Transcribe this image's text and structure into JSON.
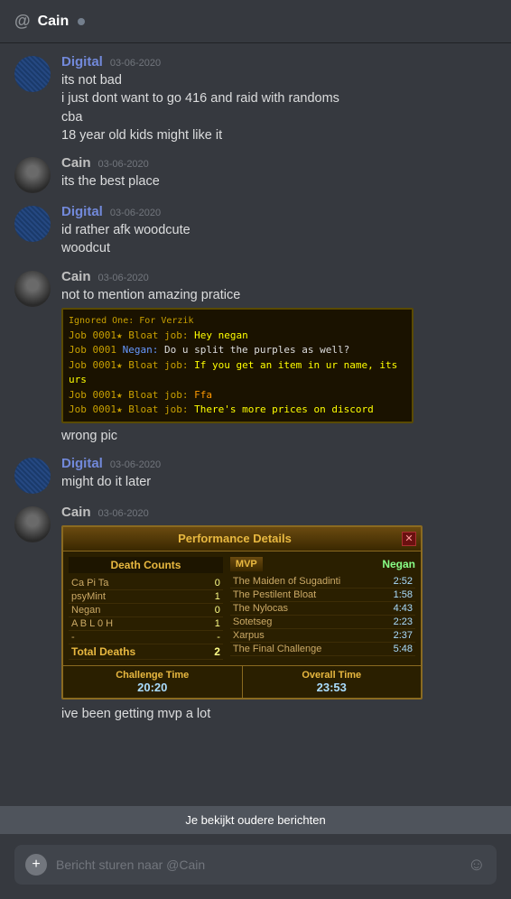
{
  "header": {
    "channel_name": "Cain",
    "status_indicator": "●"
  },
  "messages": [
    {
      "id": "msg1",
      "user": "Digital",
      "user_type": "digital",
      "timestamp": "03-06-2020",
      "lines": [
        "its not bad",
        "i just dont want to go 416 and raid with randoms",
        "cba",
        "18 year old kids might like it"
      ]
    },
    {
      "id": "msg2",
      "user": "Cain",
      "user_type": "cain",
      "timestamp": "03-06-2020",
      "lines": [
        "its the best place"
      ]
    },
    {
      "id": "msg3",
      "user": "Digital",
      "user_type": "digital",
      "timestamp": "03-06-2020",
      "lines": [
        "id rather afk woodcute",
        "woodcut"
      ]
    },
    {
      "id": "msg4",
      "user": "Cain",
      "user_type": "cain",
      "timestamp": "03-06-2020",
      "lines": [
        "not to mention amazing pratice"
      ],
      "has_game_screenshot": true,
      "screenshot": {
        "title": "Ignored One: For Verzik",
        "lines": [
          {
            "color": "gold",
            "text": "Job 0001",
            "icon": "★",
            "label": " Bloat job: ",
            "message_color": "yellow",
            "message": "Hey negan"
          },
          {
            "color": "blue",
            "text": "Job 0001",
            "icon": "",
            "label": " Negan: ",
            "message_color": "white",
            "message": "Do u split the purples as well?"
          },
          {
            "color": "gold",
            "text": "Job 0001",
            "icon": "★",
            "label": " Bloat job: ",
            "message_color": "yellow",
            "message": "If you get an item in ur name, its urs"
          },
          {
            "color": "gold",
            "text": "Job 0001",
            "icon": "★",
            "label": " Bloat job: ",
            "message_color": "orange",
            "message": "Ffa"
          },
          {
            "color": "gold",
            "text": "Job 0001",
            "icon": "★",
            "label": " Bloat job: ",
            "message_color": "yellow",
            "message": "There's more prices on discord"
          }
        ]
      },
      "extra_lines": [
        "wrong pic"
      ]
    },
    {
      "id": "msg5",
      "user": "Digital",
      "user_type": "digital",
      "timestamp": "03-06-2020",
      "lines": [
        "might do it later"
      ]
    },
    {
      "id": "msg6",
      "user": "Cain",
      "user_type": "cain",
      "timestamp": "03-06-2020",
      "lines": [],
      "has_perf_box": true,
      "perf": {
        "title": "Performance Details",
        "mvp_label": "MVP",
        "mvp_name": "Negan",
        "death_counts_title": "Death Counts",
        "deaths": [
          {
            "name": "Ca Pi Ta",
            "count": "0"
          },
          {
            "name": "psyMint",
            "count": "1"
          },
          {
            "name": "Negan",
            "count": "0"
          },
          {
            "name": "A B L 0 H",
            "count": "1"
          },
          {
            "name": "-",
            "count": "-"
          }
        ],
        "total_deaths_label": "Total Deaths",
        "total_deaths": "2",
        "boss_times": [
          {
            "name": "The Maiden of Sugadinti",
            "time": "2:52"
          },
          {
            "name": "The Pestilent Bloat",
            "time": "1:58"
          },
          {
            "name": "The Nylocas",
            "time": "4:43"
          },
          {
            "name": "Sotetseg",
            "time": "2:23"
          },
          {
            "name": "Xarpus",
            "time": "2:37"
          },
          {
            "name": "The Final Challenge",
            "time": "5:48"
          }
        ],
        "challenge_time_label": "Challenge Time",
        "challenge_time": "20:20",
        "overall_time_label": "Overall Time",
        "overall_time": "23:53"
      },
      "extra_lines": [
        "ive been getting mvp a lot"
      ]
    }
  ],
  "older_bar": {
    "text": "Je bekijkt oudere berichten"
  },
  "input": {
    "placeholder": "Bericht sturen naar @Cain"
  }
}
